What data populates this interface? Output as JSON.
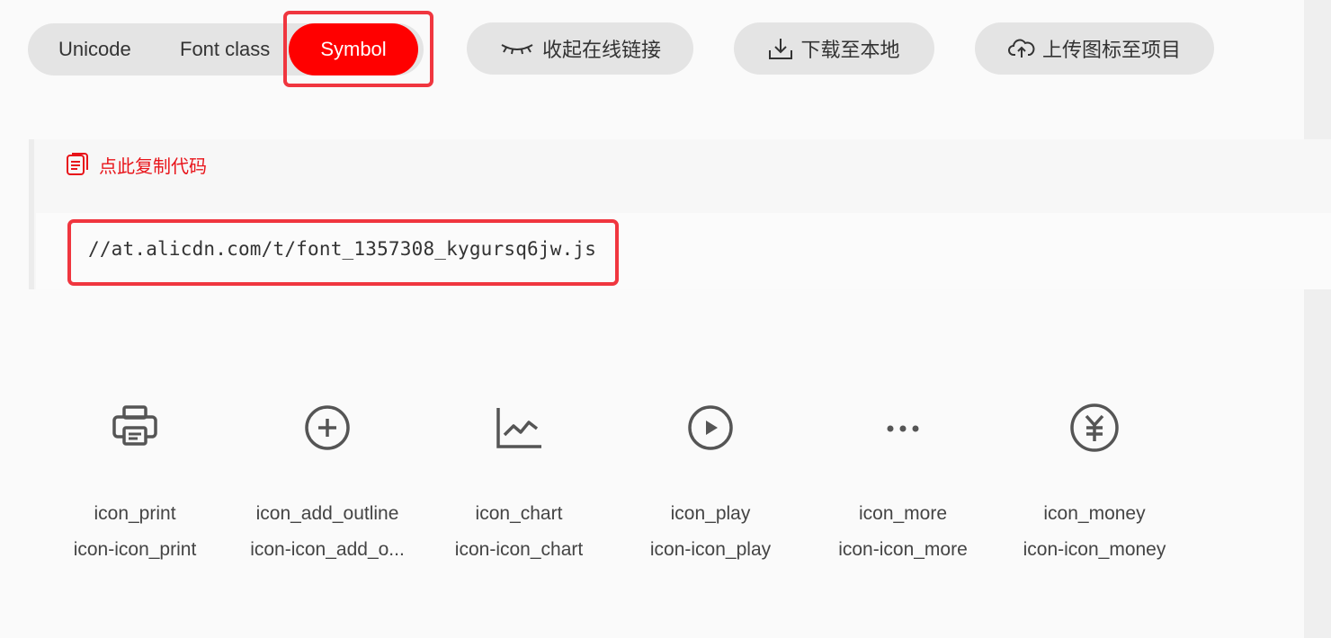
{
  "tabs": [
    {
      "label": "Unicode",
      "active": false
    },
    {
      "label": "Font class",
      "active": false
    },
    {
      "label": "Symbol",
      "active": true
    }
  ],
  "actions": {
    "collapse_label": "收起在线链接",
    "download_label": "下载至本地",
    "upload_label": "上传图标至项目"
  },
  "code": {
    "copy_label": "点此复制代码",
    "url": "//at.alicdn.com/t/font_1357308_kygursq6jw.js"
  },
  "icons": [
    {
      "name": "icon_print",
      "class": "icon-icon_print",
      "glyph": "print-icon"
    },
    {
      "name": "icon_add_outline",
      "class": "icon-icon_add_o...",
      "glyph": "add-outline-icon"
    },
    {
      "name": "icon_chart",
      "class": "icon-icon_chart",
      "glyph": "chart-icon"
    },
    {
      "name": "icon_play",
      "class": "icon-icon_play",
      "glyph": "play-icon"
    },
    {
      "name": "icon_more",
      "class": "icon-icon_more",
      "glyph": "more-icon"
    },
    {
      "name": "icon_money",
      "class": "icon-icon_money",
      "glyph": "money-icon"
    }
  ],
  "colors": {
    "accent": "#ff0000",
    "highlight_border": "#f0363f",
    "pill_bg": "#e4e4e4",
    "copy_text": "#e8141a"
  }
}
